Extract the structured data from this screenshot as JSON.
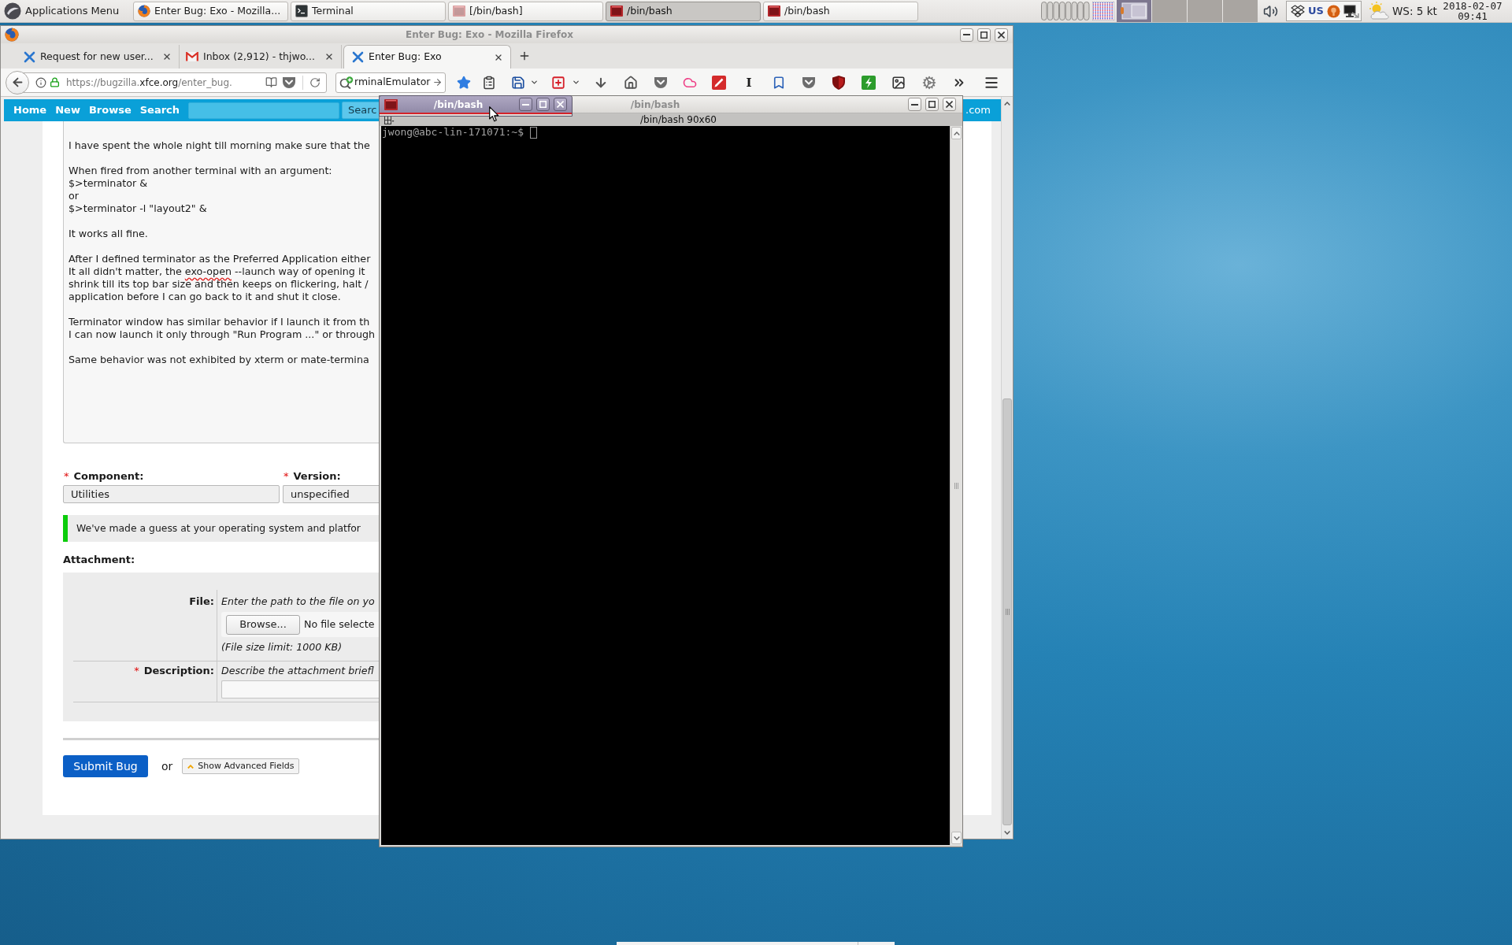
{
  "panel": {
    "app_menu": "Applications Menu",
    "tasks": [
      {
        "label": "Enter Bug: Exo - Mozilla...",
        "kind": "browser",
        "minimized": false,
        "selected": false
      },
      {
        "label": "Terminal",
        "kind": "terminal",
        "minimized": false,
        "selected": false
      },
      {
        "label": "[/bin/bash]",
        "kind": "bash",
        "minimized": true,
        "selected": false
      },
      {
        "label": "/bin/bash",
        "kind": "bash",
        "minimized": false,
        "selected": true
      },
      {
        "label": "/bin/bash",
        "kind": "bash",
        "minimized": false,
        "selected": false
      }
    ],
    "workspaces": [
      {
        "selected": true
      },
      {
        "selected": false
      },
      {
        "selected": false
      },
      {
        "selected": false
      }
    ],
    "keyboard_layout": "US",
    "weather": "WS: 5 kt",
    "date": "2018-02-07",
    "time": "09:41"
  },
  "browser": {
    "title": "Enter Bug: Exo - Mozilla Firefox",
    "active": false,
    "tabs": [
      {
        "label": "Request for new user...",
        "kind": "site",
        "selected": false
      },
      {
        "label": "Inbox (2,912) - thjwo...",
        "kind": "mail",
        "selected": false
      },
      {
        "label": "Enter Bug: Exo",
        "kind": "site",
        "selected": true
      }
    ],
    "url": {
      "prefix": "https://bugzilla.",
      "domain": "xfce.org",
      "path": "/enter_bug."
    },
    "search_value": "rminalEmulator",
    "extension_letter": "I",
    "page": {
      "nav_links": [
        "Home",
        "New",
        "Browse",
        "Search"
      ],
      "nav_search_button": "Searc",
      "nav_trailing": ".com",
      "description": [
        [
          "I have spent the whole night till morning make sure that the"
        ],
        [
          "When fired from another terminal with an argument:",
          "$>terminator &",
          "or",
          "$>terminator -l \"layout2\" &"
        ],
        [
          "It works all fine."
        ],
        [
          "After I defined terminator as the Preferred Application either",
          {
            "segments": [
              {
                "text": "It all didn't matter, the ",
                "misspelled": false
              },
              {
                "text": "exo-open",
                "misspelled": true
              },
              {
                "text": " --launch way of opening it",
                "misspelled": false
              }
            ]
          },
          "shrink till its top bar size and then keeps on flickering, halt /",
          "application before I can go back to it and shut it close."
        ],
        [
          "Terminator window has similar behavior if I launch it from th",
          "I can now launch it only through \"Run Program ...\" or through"
        ],
        [
          "Same behavior was not exhibited by xterm or mate-termina"
        ]
      ],
      "fields": [
        {
          "mark": "*",
          "label": "Component:",
          "value": "Utilities"
        },
        {
          "mark": "*",
          "label": "Version:",
          "value": "unspecified"
        }
      ],
      "notice": "We've made a guess at your operating system and platfor",
      "attachment": {
        "heading": "Attachment:",
        "file_label": "File:",
        "file_hint": "Enter the path to the file on yo",
        "browse_button": "Browse...",
        "no_file": "No file selecte",
        "size_limit": "(File size limit: 1000 KB)",
        "description_mark": "*",
        "description_label": "Description:",
        "description_hint": "Describe the attachment briefl"
      },
      "submit_button": "Submit Bug",
      "or": "or",
      "advanced_button": "Show Advanced Fields"
    }
  },
  "terminal_back": {
    "title": "/bin/bash",
    "active": false,
    "pane_title": "/bin/bash 90x60",
    "prompt": "jwong@abc-lin-171071:~$"
  },
  "terminal_front": {
    "title": "/bin/bash",
    "active": true
  }
}
